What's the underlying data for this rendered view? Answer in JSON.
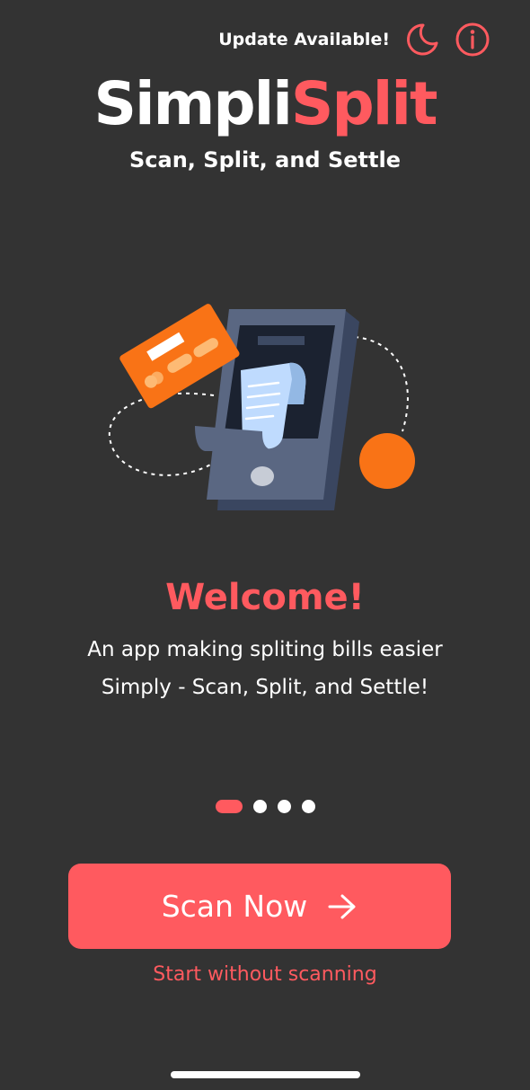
{
  "header": {
    "update_label": "Update Available!",
    "theme_icon": "moon-icon",
    "info_icon": "info-icon"
  },
  "brand": {
    "name_part1": "Simpli",
    "name_part2": "Split",
    "tagline": "Scan, Split, and Settle",
    "accent_color": "#ff5a5f",
    "secondary_color": "#f97316"
  },
  "onboarding": {
    "title": "Welcome!",
    "line1": "An app making spliting bills easier",
    "line2": "Simply - Scan, Split, and Settle!",
    "pages": 4,
    "current_page": 1
  },
  "actions": {
    "primary_label": "Scan Now",
    "primary_icon": "arrow-right-icon",
    "secondary_label": "Start without scanning"
  }
}
